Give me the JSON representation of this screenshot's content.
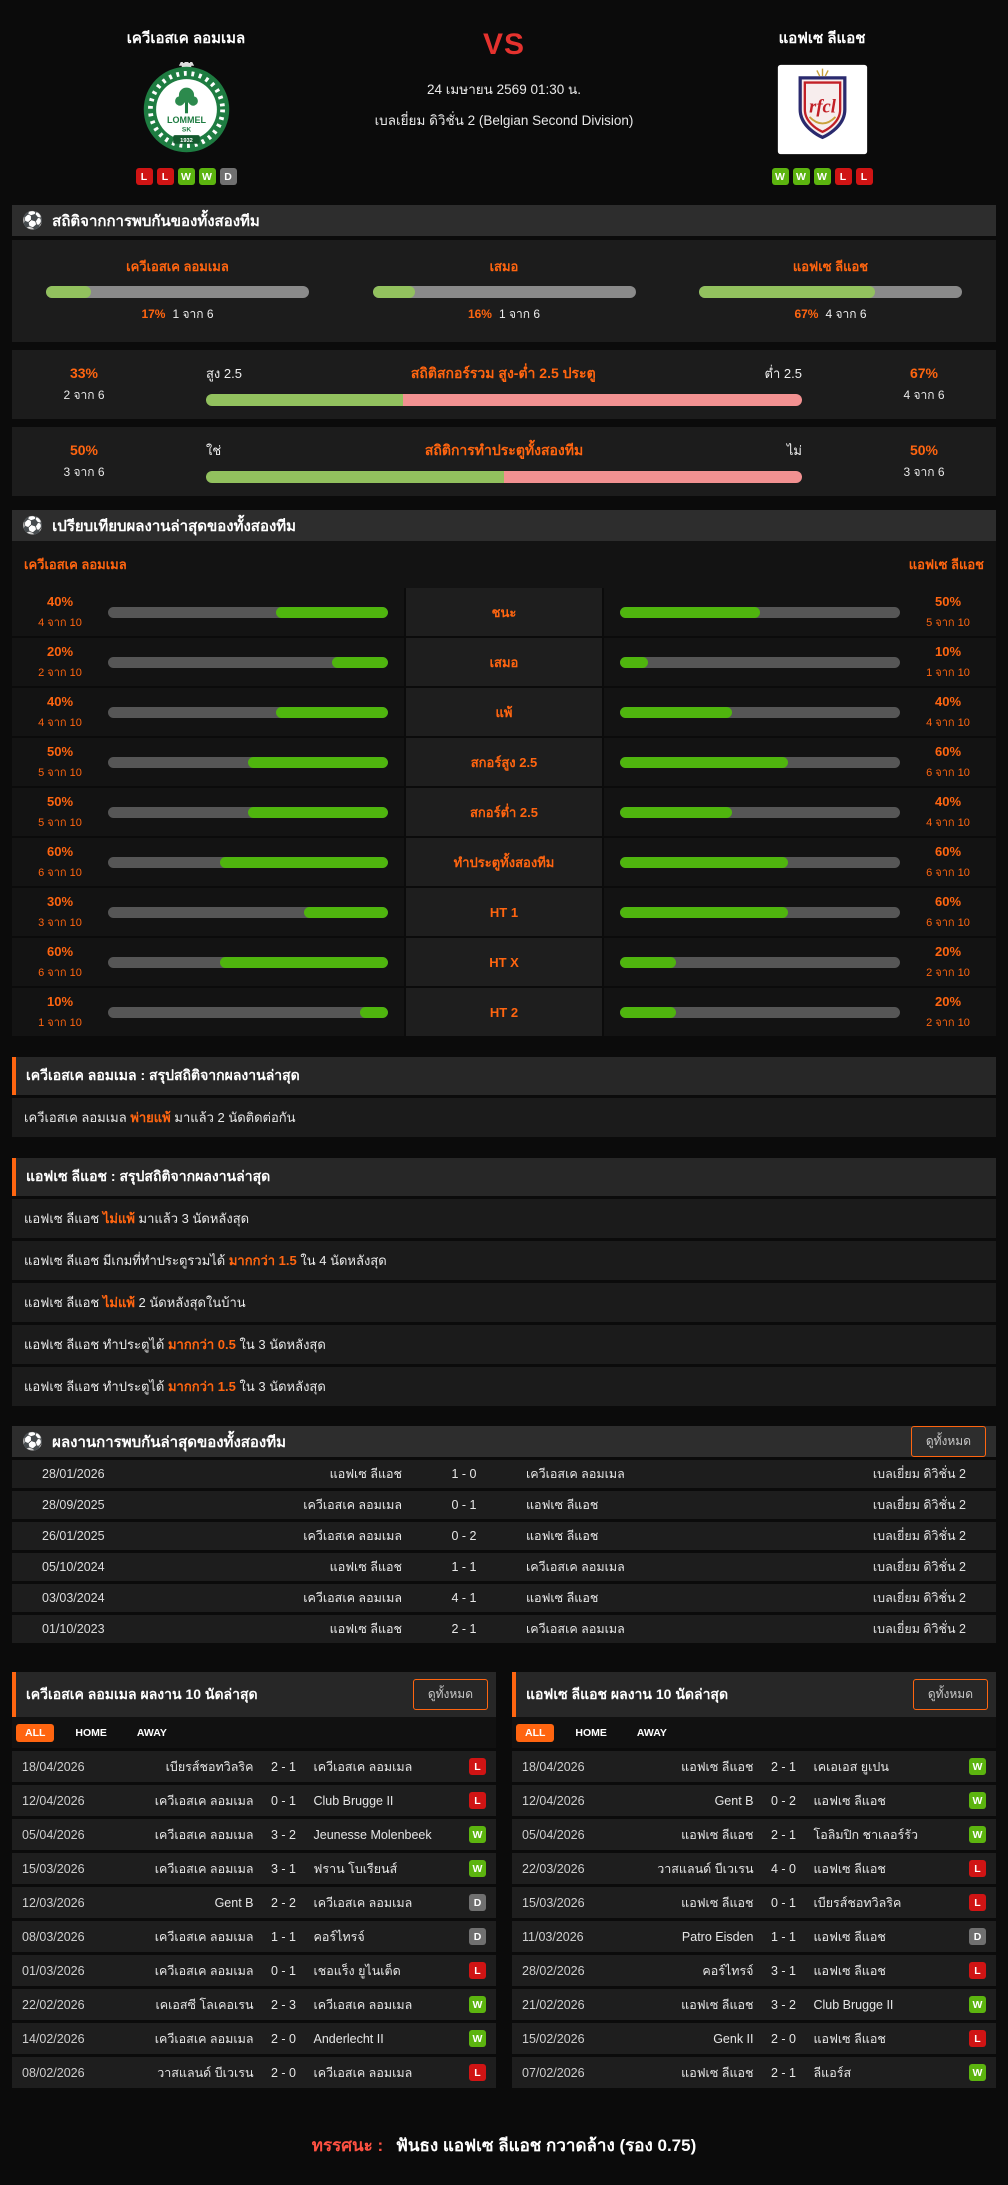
{
  "colors": {
    "accent": "#ff6510",
    "vs_red": "#e5322e",
    "bar_green_soft": "#92c15e",
    "bar_pink": "#f29191",
    "bar_gray": "#8a8a8a",
    "bar_green_bright": "#4fb50e",
    "track_dark": "#565656",
    "win": "#5cb40f",
    "lose": "#d01414",
    "draw": "#707070"
  },
  "header": {
    "home_team": "เควีเอสเค ลอมเมล",
    "away_team": "แอฟเซ ลีแอช",
    "vs": "VS",
    "datetime": "24 เมษายน 2569 01:30 น.",
    "league": "เบลเยี่ยม ดิวิชั่น 2 (Belgian Second Division)",
    "home_logo": {
      "line1": "LOMMEL",
      "line2": "SK",
      "year": "1932"
    },
    "away_logo": {
      "text": "rfcl"
    },
    "home_form": [
      "L",
      "L",
      "W",
      "W",
      "D"
    ],
    "away_form": [
      "W",
      "W",
      "W",
      "L",
      "L"
    ]
  },
  "h2h_stats": {
    "title": "สถิติจากการพบกันของทั้งสองทีม",
    "win_bars": [
      {
        "label": "เควีเอสเค ลอมเมล",
        "pct": "17%",
        "count": "1 จาก 6",
        "value": 17
      },
      {
        "label": "เสมอ",
        "pct": "16%",
        "count": "1 จาก 6",
        "value": 16
      },
      {
        "label": "แอฟเซ ลีแอช",
        "pct": "67%",
        "count": "4 จาก 6",
        "value": 67
      }
    ],
    "duo_bars": [
      {
        "title": "สถิติสกอร์รวม สูง-ต่ำ 2.5 ประตู",
        "left_label": "สูง 2.5",
        "right_label": "ต่ำ 2.5",
        "left_pct": "33%",
        "left_count": "2 จาก 6",
        "right_pct": "67%",
        "right_count": "4 จาก 6",
        "left_value": 33
      },
      {
        "title": "สถิติการทำประตูทั้งสองทีม",
        "left_label": "ใช่",
        "right_label": "ไม่",
        "left_pct": "50%",
        "left_count": "3 จาก 6",
        "right_pct": "50%",
        "right_count": "3 จาก 6",
        "left_value": 50
      }
    ]
  },
  "comparison": {
    "title": "เปรียบเทียบผลงานล่าสุดของทั้งสองทีม",
    "home_team": "เควีเอสเค ลอมเมล",
    "away_team": "แอฟเซ ลีแอช",
    "rows": [
      {
        "label": "ชนะ",
        "home_pct": "40%",
        "home_count": "4 จาก 10",
        "home_value": 40,
        "away_pct": "50%",
        "away_count": "5 จาก 10",
        "away_value": 50
      },
      {
        "label": "เสมอ",
        "home_pct": "20%",
        "home_count": "2 จาก 10",
        "home_value": 20,
        "away_pct": "10%",
        "away_count": "1 จาก 10",
        "away_value": 10
      },
      {
        "label": "แพ้",
        "home_pct": "40%",
        "home_count": "4 จาก 10",
        "home_value": 40,
        "away_pct": "40%",
        "away_count": "4 จาก 10",
        "away_value": 40
      },
      {
        "label": "สกอร์สูง 2.5",
        "home_pct": "50%",
        "home_count": "5 จาก 10",
        "home_value": 50,
        "away_pct": "60%",
        "away_count": "6 จาก 10",
        "away_value": 60
      },
      {
        "label": "สกอร์ต่ำ 2.5",
        "home_pct": "50%",
        "home_count": "5 จาก 10",
        "home_value": 50,
        "away_pct": "40%",
        "away_count": "4 จาก 10",
        "away_value": 40
      },
      {
        "label": "ทำประตูทั้งสองทีม",
        "home_pct": "60%",
        "home_count": "6 จาก 10",
        "home_value": 60,
        "away_pct": "60%",
        "away_count": "6 จาก 10",
        "away_value": 60
      },
      {
        "label": "HT 1",
        "home_pct": "30%",
        "home_count": "3 จาก 10",
        "home_value": 30,
        "away_pct": "60%",
        "away_count": "6 จาก 10",
        "away_value": 60
      },
      {
        "label": "HT X",
        "home_pct": "60%",
        "home_count": "6 จาก 10",
        "home_value": 60,
        "away_pct": "20%",
        "away_count": "2 จาก 10",
        "away_value": 20
      },
      {
        "label": "HT 2",
        "home_pct": "10%",
        "home_count": "1 จาก 10",
        "home_value": 10,
        "away_pct": "20%",
        "away_count": "2 จาก 10",
        "away_value": 20
      }
    ]
  },
  "home_summary": {
    "title": "เควีเอสเค ลอมเมล : สรุปสถิติจากผลงานล่าสุด",
    "rows": [
      {
        "pre": "เควีเอสเค ลอมเมล ",
        "highlight": "พ่ายแพ้",
        "post": " มาแล้ว 2 นัดติดต่อกัน"
      }
    ]
  },
  "away_summary": {
    "title": "แอฟเซ ลีแอช : สรุปสถิติจากผลงานล่าสุด",
    "rows": [
      {
        "pre": "แอฟเซ ลีแอช ",
        "highlight": "ไม่แพ้",
        "post": " มาแล้ว 3 นัดหลังสุด"
      },
      {
        "pre": "แอฟเซ ลีแอช มีเกมที่ทำประตูรวมได้ ",
        "highlight": "มากกว่า 1.5",
        "post": " ใน 4 นัดหลังสุด"
      },
      {
        "pre": "แอฟเซ ลีแอช ",
        "highlight": "ไม่แพ้",
        "post": " 2 นัดหลังสุดในบ้าน"
      },
      {
        "pre": "แอฟเซ ลีแอช ทำประตูได้ ",
        "highlight": "มากกว่า 0.5",
        "post": " ใน 3 นัดหลังสุด"
      },
      {
        "pre": "แอฟเซ ลีแอช ทำประตูได้ ",
        "highlight": "มากกว่า 1.5",
        "post": " ใน 3 นัดหลังสุด"
      }
    ]
  },
  "h2h_results": {
    "title": "ผลงานการพบกันล่าสุดของทั้งสองทีม",
    "view_all": "ดูทั้งหมด",
    "rows": [
      {
        "date": "28/01/2026",
        "home": "แอฟเซ ลีแอช",
        "score": "1 - 0",
        "away": "เควีเอสเค ลอมเมล",
        "league": "เบลเยี่ยม ดิวิชั่น 2"
      },
      {
        "date": "28/09/2025",
        "home": "เควีเอสเค ลอมเมล",
        "score": "0 - 1",
        "away": "แอฟเซ ลีแอช",
        "league": "เบลเยี่ยม ดิวิชั่น 2"
      },
      {
        "date": "26/01/2025",
        "home": "เควีเอสเค ลอมเมล",
        "score": "0 - 2",
        "away": "แอฟเซ ลีแอช",
        "league": "เบลเยี่ยม ดิวิชั่น 2"
      },
      {
        "date": "05/10/2024",
        "home": "แอฟเซ ลีแอช",
        "score": "1 - 1",
        "away": "เควีเอสเค ลอมเมล",
        "league": "เบลเยี่ยม ดิวิชั่น 2"
      },
      {
        "date": "03/03/2024",
        "home": "เควีเอสเค ลอมเมล",
        "score": "4 - 1",
        "away": "แอฟเซ ลีแอช",
        "league": "เบลเยี่ยม ดิวิชั่น 2"
      },
      {
        "date": "01/10/2023",
        "home": "แอฟเซ ลีแอช",
        "score": "2 - 1",
        "away": "เควีเอสเค ลอมเมล",
        "league": "เบลเยี่ยม ดิวิชั่น 2"
      }
    ]
  },
  "home_recent": {
    "title": "เควีเอสเค ลอมเมล ผลงาน 10 นัดล่าสุด",
    "view_all": "ดูทั้งหมด",
    "tabs": [
      "ALL",
      "HOME",
      "AWAY"
    ],
    "active_tab": "ALL",
    "rows": [
      {
        "date": "18/04/2026",
        "home": "เบียรส์ชอทวิลริค",
        "score": "2 - 1",
        "away": "เควีเอสเค ลอมเมล",
        "result": "L"
      },
      {
        "date": "12/04/2026",
        "home": "เควีเอสเค ลอมเมล",
        "score": "0 - 1",
        "away": "Club Brugge II",
        "result": "L"
      },
      {
        "date": "05/04/2026",
        "home": "เควีเอสเค ลอมเมล",
        "score": "3 - 2",
        "away": "Jeunesse Molenbeek",
        "result": "W"
      },
      {
        "date": "15/03/2026",
        "home": "เควีเอสเค ลอมเมล",
        "score": "3 - 1",
        "away": "ฟราน โบเรียนส์",
        "result": "W"
      },
      {
        "date": "12/03/2026",
        "home": "Gent B",
        "score": "2 - 2",
        "away": "เควีเอสเค ลอมเมล",
        "result": "D"
      },
      {
        "date": "08/03/2026",
        "home": "เควีเอสเค ลอมเมล",
        "score": "1 - 1",
        "away": "คอร์ไทรจ์",
        "result": "D"
      },
      {
        "date": "01/03/2026",
        "home": "เควีเอสเค ลอมเมล",
        "score": "0 - 1",
        "away": "เชอแร็ง ยูไนเต็ด",
        "result": "L"
      },
      {
        "date": "22/02/2026",
        "home": "เคเอสซี โลเคอเรน",
        "score": "2 - 3",
        "away": "เควีเอสเค ลอมเมล",
        "result": "W"
      },
      {
        "date": "14/02/2026",
        "home": "เควีเอสเค ลอมเมล",
        "score": "2 - 0",
        "away": "Anderlecht II",
        "result": "W"
      },
      {
        "date": "08/02/2026",
        "home": "วาสแลนด์ บีเวเรน",
        "score": "2 - 0",
        "away": "เควีเอสเค ลอมเมล",
        "result": "L"
      }
    ]
  },
  "away_recent": {
    "title": "แอฟเซ ลีแอช ผลงาน 10 นัดล่าสุด",
    "view_all": "ดูทั้งหมด",
    "tabs": [
      "ALL",
      "HOME",
      "AWAY"
    ],
    "active_tab": "ALL",
    "rows": [
      {
        "date": "18/04/2026",
        "home": "แอฟเซ ลีแอช",
        "score": "2 - 1",
        "away": "เคเอเอส ยูเปน",
        "result": "W"
      },
      {
        "date": "12/04/2026",
        "home": "Gent B",
        "score": "0 - 2",
        "away": "แอฟเซ ลีแอช",
        "result": "W"
      },
      {
        "date": "05/04/2026",
        "home": "แอฟเซ ลีแอช",
        "score": "2 - 1",
        "away": "โอลิมปิก ชาเลอร์รัว",
        "result": "W"
      },
      {
        "date": "22/03/2026",
        "home": "วาสแลนด์ บีเวเรน",
        "score": "4 - 0",
        "away": "แอฟเซ ลีแอช",
        "result": "L"
      },
      {
        "date": "15/03/2026",
        "home": "แอฟเซ ลีแอช",
        "score": "0 - 1",
        "away": "เบียรส์ชอทวิลริค",
        "result": "L"
      },
      {
        "date": "11/03/2026",
        "home": "Patro Eisden",
        "score": "1 - 1",
        "away": "แอฟเซ ลีแอช",
        "result": "D"
      },
      {
        "date": "28/02/2026",
        "home": "คอร์ไทรจ์",
        "score": "3 - 1",
        "away": "แอฟเซ ลีแอช",
        "result": "L"
      },
      {
        "date": "21/02/2026",
        "home": "แอฟเซ ลีแอช",
        "score": "3 - 2",
        "away": "Club Brugge II",
        "result": "W"
      },
      {
        "date": "15/02/2026",
        "home": "Genk II",
        "score": "2 - 0",
        "away": "แอฟเซ ลีแอช",
        "result": "L"
      },
      {
        "date": "07/02/2026",
        "home": "แอฟเซ ลีแอช",
        "score": "2 - 1",
        "away": "ลีแอร์ส",
        "result": "W"
      }
    ]
  },
  "footer": {
    "tip_label": "ทรรศนะ :",
    "tip_text": "ฟันธง แอฟเซ ลีแอช กวาดล้าง (รอง 0.75)"
  },
  "icons": {
    "section": "soccer-ball"
  }
}
